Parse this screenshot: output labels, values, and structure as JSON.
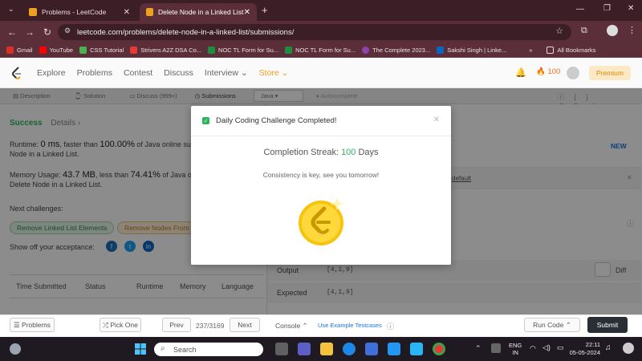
{
  "browser": {
    "tabs": [
      {
        "label": "Problems - LeetCode"
      },
      {
        "label": "Delete Node in a Linked List - L"
      }
    ],
    "url": "leetcode.com/problems/delete-node-in-a-linked-list/submissions/",
    "bookmarks": [
      "Gmail",
      "YouTube",
      "CSS Tutorial",
      "Strivers A2Z DSA Co...",
      "NOC TL Form for Su...",
      "NOC TL Form for Su...",
      "The Complete 2023...",
      "Sakshi Singh | Linke..."
    ],
    "all_bookmarks": "All Bookmarks"
  },
  "nav": {
    "links": [
      "Explore",
      "Problems",
      "Contest",
      "Discuss",
      "Interview"
    ],
    "store": "Store",
    "coins": "100",
    "premium": "Premium"
  },
  "subtabs": {
    "description": "Description",
    "solution": "Solution",
    "discuss": "Discuss (999+)",
    "submissions": "Submissions",
    "language": "Java",
    "autocomplete": "Autocomplete"
  },
  "result": {
    "status": "Success",
    "details": "Details",
    "runtime_prefix": "Runtime:",
    "runtime_value": "0 ms",
    "runtime_mid": ", faster than",
    "runtime_pct": "100.00%",
    "runtime_suffix": "of Java online sub",
    "runtime_line2": "Node in a Linked List.",
    "memory_prefix": "Memory Usage:",
    "memory_value": "43.7 MB",
    "memory_mid": ", less than",
    "memory_pct": "74.41%",
    "memory_suffix": "of Java o",
    "memory_line2": "Delete Node in a Linked List.",
    "next_challenges": "Next challenges:",
    "challenge1": "Remove Linked List Elements",
    "challenge2": "Remove Nodes From",
    "show_off": "Show off your acceptance:"
  },
  "table": {
    "headers": [
      "Time Submitted",
      "Status",
      "Runtime",
      "Memory",
      "Language"
    ]
  },
  "right": {
    "new_badge": "NEW",
    "default_text": "default",
    "output_label": "Output",
    "output_value": "[4,1,9]",
    "diff": "Diff",
    "expected_label": "Expected",
    "expected_value": "[4,1,9]"
  },
  "bottom": {
    "problems": "Problems",
    "pick_one": "Pick One",
    "prev": "Prev",
    "counter": "237/3169",
    "next": "Next",
    "console": "Console",
    "example_testcases": "Use Example Testcases",
    "run_code": "Run Code",
    "submit": "Submit"
  },
  "modal": {
    "title": "Daily Coding Challenge Completed!",
    "streak_label": "Completion Streak:",
    "streak_value": "100",
    "streak_unit": "Days",
    "message": "Consistency is key, see you tomorrow!"
  },
  "taskbar": {
    "search": "Search",
    "lang_top": "ENG",
    "lang_bottom": "IN",
    "time": "22:11",
    "date": "05-05-2024"
  },
  "colors": {
    "accent_green": "#2db55d",
    "brand_orange": "#f0a020",
    "chrome_dark": "#3c1f26"
  }
}
